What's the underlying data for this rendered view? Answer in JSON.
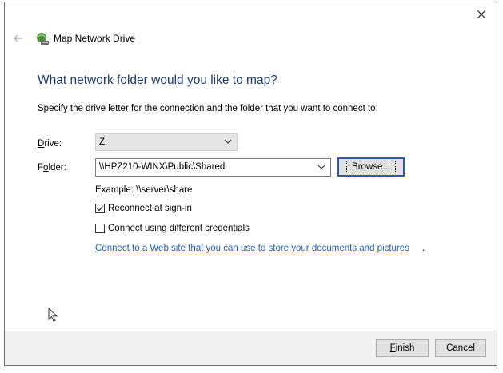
{
  "window": {
    "title": "Map Network Drive",
    "heading": "What network folder would you like to map?",
    "instructions": "Specify the drive letter for the connection and the folder that you want to connect to:"
  },
  "drive": {
    "label_accel": "D",
    "label_rest": "rive:",
    "value": "Z:"
  },
  "folder": {
    "label_pre": "F",
    "label_accel": "o",
    "label_rest": "lder:",
    "value": "\\\\HPZ210-WINX\\Public\\Shared"
  },
  "browse": {
    "label": "Browse..."
  },
  "example": "Example: \\\\server\\share",
  "reconnect": {
    "label_accel": "R",
    "label_rest": "econnect at sign-in",
    "checked": true
  },
  "credentials": {
    "label_pre": "Connect using different ",
    "label_accel": "c",
    "label_rest": "redentials",
    "checked": false
  },
  "link": {
    "text": "Connect to a Web site that you can use to store your documents and pictures",
    "period": "."
  },
  "footer": {
    "finish_accel": "F",
    "finish_rest": "inish",
    "cancel": "Cancel"
  },
  "icons": [
    "close-icon",
    "back-arrow-icon",
    "network-drive-icon",
    "chevron-down-icon",
    "checkmark-icon",
    "mouse-cursor-icon"
  ]
}
